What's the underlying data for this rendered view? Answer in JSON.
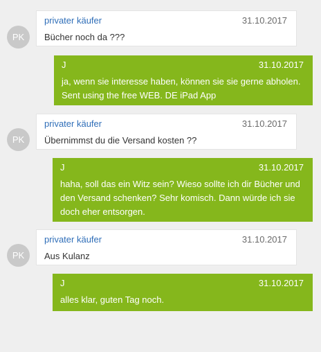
{
  "messages": [
    {
      "sender": "privater käufer",
      "date": "31.10.2017",
      "avatar": "PK",
      "lines": [
        "Bücher noch da ???"
      ]
    },
    {
      "sender": "J",
      "date": "31.10.2017",
      "lines": [
        "ja, wenn sie interesse haben, können sie sie gerne abholen.",
        "Sent using the free WEB. DE iPad App"
      ]
    },
    {
      "sender": "privater käufer",
      "date": "31.10.2017",
      "avatar": "PK",
      "lines": [
        "Übernimmst du die Versand kosten ??"
      ]
    },
    {
      "sender": "J",
      "date": "31.10.2017",
      "lines": [
        "haha, soll das ein Witz sein? Wieso sollte ich dir Bücher und",
        "den Versand schenken? Sehr komisch. Dann würde ich sie",
        "doch eher entsorgen."
      ]
    },
    {
      "sender": "privater käufer",
      "date": "31.10.2017",
      "avatar": "PK",
      "lines": [
        "Aus Kulanz"
      ]
    },
    {
      "sender": "J",
      "date": "31.10.2017",
      "lines": [
        "alles klar, guten Tag noch."
      ]
    }
  ],
  "colors": {
    "outgoing_bubble": "#85b71c",
    "incoming_bubble": "#ffffff",
    "sender_link": "#2f6eb8",
    "avatar": "#c9c9c9"
  }
}
